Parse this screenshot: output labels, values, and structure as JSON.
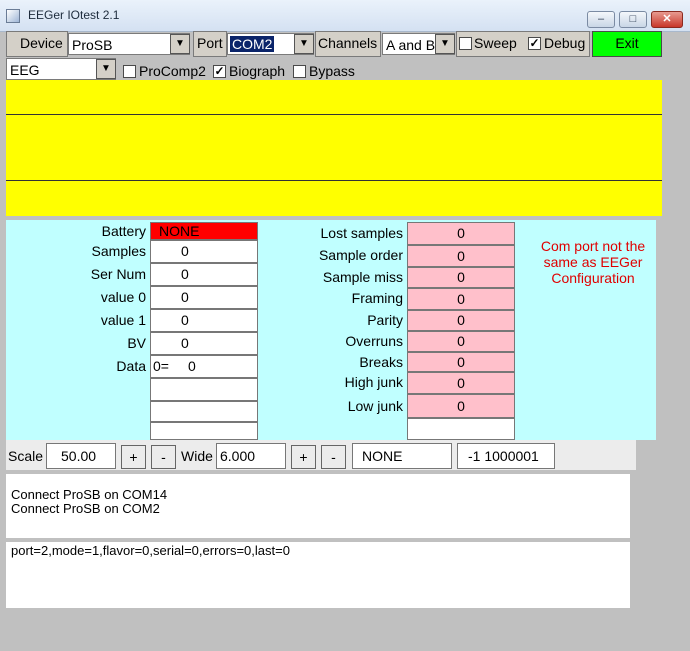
{
  "window": {
    "title": "EEGer IOtest 2.1"
  },
  "toolbar": {
    "device_label": "Device",
    "device_value": "ProSB",
    "port_label": "Port",
    "port_value": "COM2",
    "channels_label": "Channels",
    "channels_value": "A and B",
    "sweep_label": "Sweep",
    "sweep_checked": false,
    "debug_label": "Debug",
    "debug_checked": true,
    "exit_label": "Exit",
    "exit_color": "#00ff00"
  },
  "toolbar2": {
    "mode_value": "EEG",
    "procomp2_label": "ProComp2",
    "procomp2_checked": false,
    "biograph_label": "Biograph",
    "biograph_checked": true,
    "bypass_label": "Bypass",
    "bypass_checked": false
  },
  "status_left": {
    "battery_label": "Battery",
    "battery_value": "NONE",
    "samples_label": "Samples",
    "samples_value": "0",
    "sernum_label": "Ser Num",
    "sernum_value": "0",
    "value0_label": "value 0",
    "value0_value": "0",
    "value1_label": "value 1",
    "value1_value": "0",
    "bv_label": "BV",
    "bv_value": "0",
    "data_label": "Data",
    "data_prefix": "0=",
    "data_value": "0"
  },
  "status_right": {
    "lost_label": "Lost samples",
    "lost_value": "0",
    "order_label": "Sample order",
    "order_value": "0",
    "miss_label": "Sample miss",
    "miss_value": "0",
    "framing_label": "Framing",
    "framing_value": "0",
    "parity_label": "Parity",
    "parity_value": "0",
    "overruns_label": "Overruns",
    "overruns_value": "0",
    "breaks_label": "Breaks",
    "breaks_value": "0",
    "highjunk_label": "High junk",
    "highjunk_value": "0",
    "lowjunk_label": "Low junk",
    "lowjunk_value": "0"
  },
  "message": {
    "line1": "Com port not the",
    "line2": "same as EEGer",
    "line3": "Configuration"
  },
  "controls": {
    "scale_label": "Scale",
    "scale_value": "50.00",
    "plus_label": "+",
    "minus_label": "-",
    "wide_label": "Wide",
    "wide_value": "6.000",
    "field3_value": "NONE",
    "field4_value": "-1  1000001"
  },
  "log1": {
    "text": "Connect ProSB on COM14\nConnect ProSB on COM2"
  },
  "log2": {
    "text": "port=2,mode=1,flavor=0,serial=0,errors=0,last=0"
  },
  "colors": {
    "plot": "#ffff00",
    "panel": "#c0ffff",
    "battery": "#ff0000",
    "counters": "#ffc0cb",
    "message": "#e00000",
    "port_highlight": "#0a246a"
  }
}
